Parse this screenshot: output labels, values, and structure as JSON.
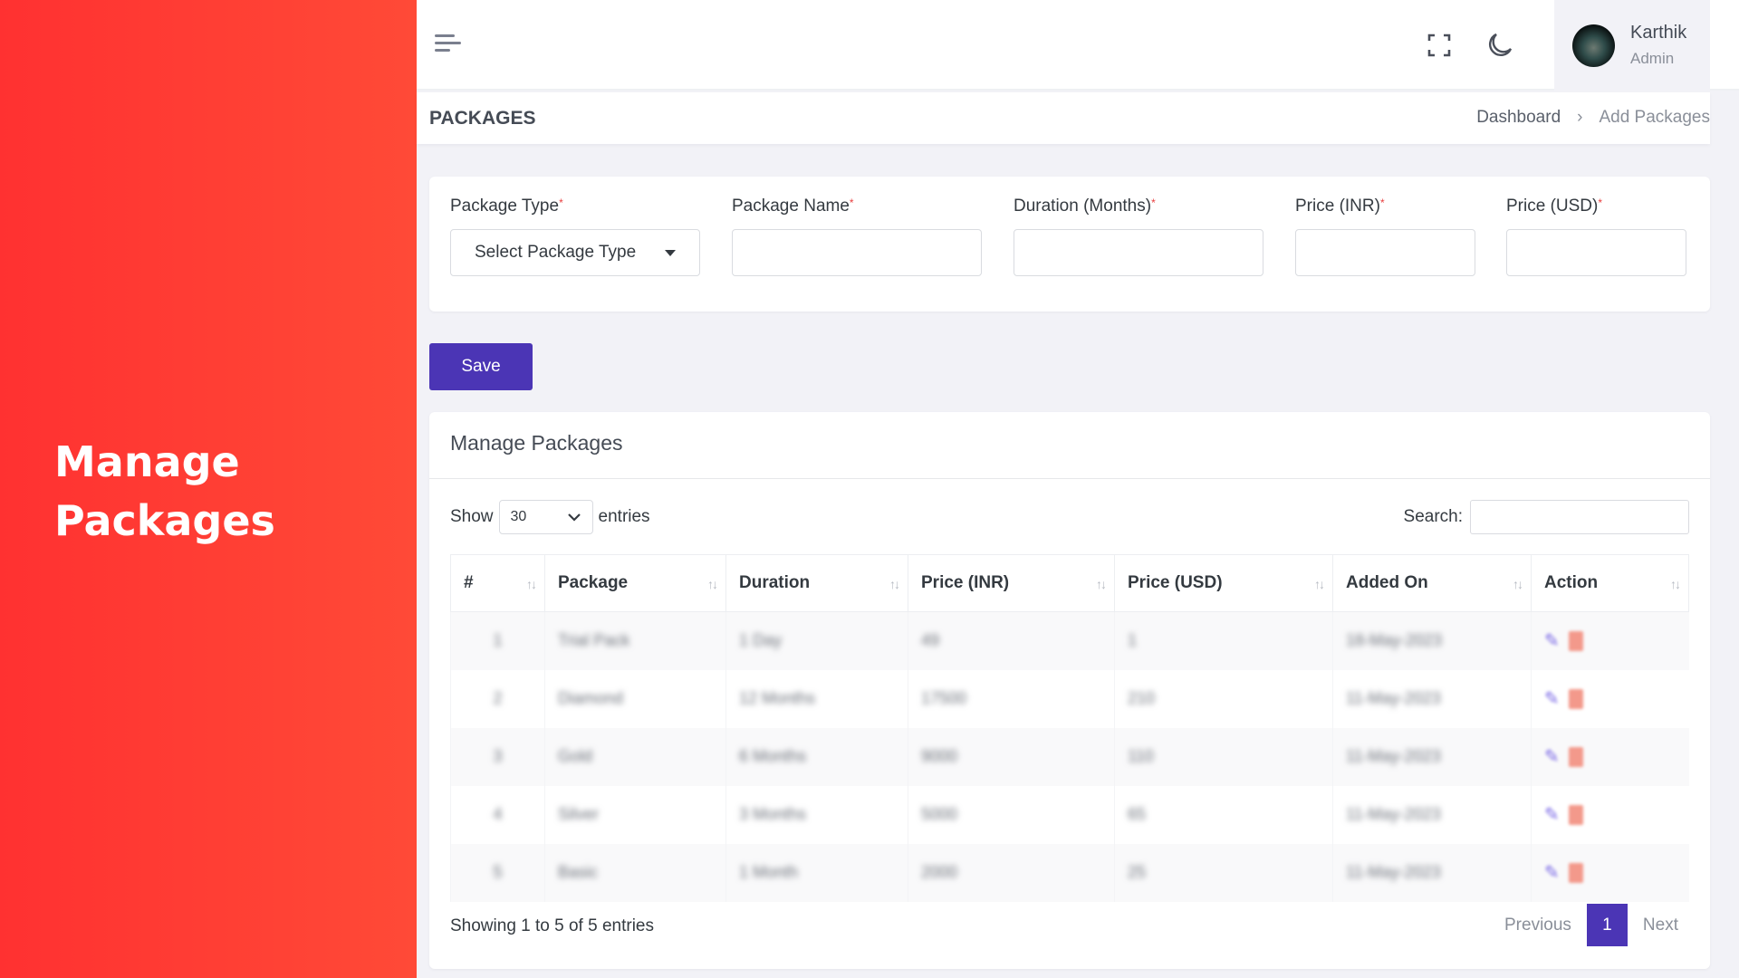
{
  "promo": {
    "title_line1": "Manage",
    "title_line2": "Packages",
    "background": "#ff3b33"
  },
  "topbar": {
    "menu_icon": "hamburger-icon",
    "fullscreen_icon": "fullscreen-icon",
    "theme_icon": "moon-icon",
    "user": {
      "name": "Karthik",
      "role": "Admin"
    }
  },
  "page_header": {
    "title": "PACKAGES",
    "breadcrumb": [
      "Dashboard",
      "Add Packages"
    ],
    "breadcrumb_separator": "›"
  },
  "form": {
    "fields": [
      {
        "label": "Package Type",
        "required": "*",
        "type": "select",
        "value": "Select Package Type"
      },
      {
        "label": "Package Name",
        "required": "*",
        "type": "text",
        "value": ""
      },
      {
        "label": "Duration (Months)",
        "required": "*",
        "type": "text",
        "value": ""
      },
      {
        "label": "Price (INR)",
        "required": "*",
        "type": "text",
        "value": ""
      },
      {
        "label": "Price (USD)",
        "required": "*",
        "type": "text",
        "value": ""
      }
    ],
    "save_label": "Save",
    "accent": "#4b35b5"
  },
  "table_card": {
    "title": "Manage Packages",
    "show_label": "Show",
    "entries_value": "30",
    "entries_label": "entries",
    "search_label": "Search:",
    "search_value": "",
    "columns": [
      "#",
      "Package",
      "Duration",
      "Price (INR)",
      "Price (USD)",
      "Added On",
      "Action"
    ],
    "sort_icon": "↑↓",
    "rows": [
      {
        "no": "1",
        "package": "Trial Pack",
        "duration": "1 Day",
        "price_inr": "49",
        "price_usd": "1",
        "added_on": "18-May-2023"
      },
      {
        "no": "2",
        "package": "Diamond",
        "duration": "12 Months",
        "price_inr": "17500",
        "price_usd": "210",
        "added_on": "11-May-2023"
      },
      {
        "no": "3",
        "package": "Gold",
        "duration": "6 Months",
        "price_inr": "9000",
        "price_usd": "110",
        "added_on": "11-May-2023"
      },
      {
        "no": "4",
        "package": "Silver",
        "duration": "3 Months",
        "price_inr": "5000",
        "price_usd": "65",
        "added_on": "11-May-2023"
      },
      {
        "no": "5",
        "package": "Basic",
        "duration": "1 Month",
        "price_inr": "2000",
        "price_usd": "25",
        "added_on": "11-May-2023"
      }
    ],
    "info": "Showing 1 to 5 of 5 entries",
    "pagination": {
      "previous": "Previous",
      "current": "1",
      "next": "Next"
    }
  }
}
